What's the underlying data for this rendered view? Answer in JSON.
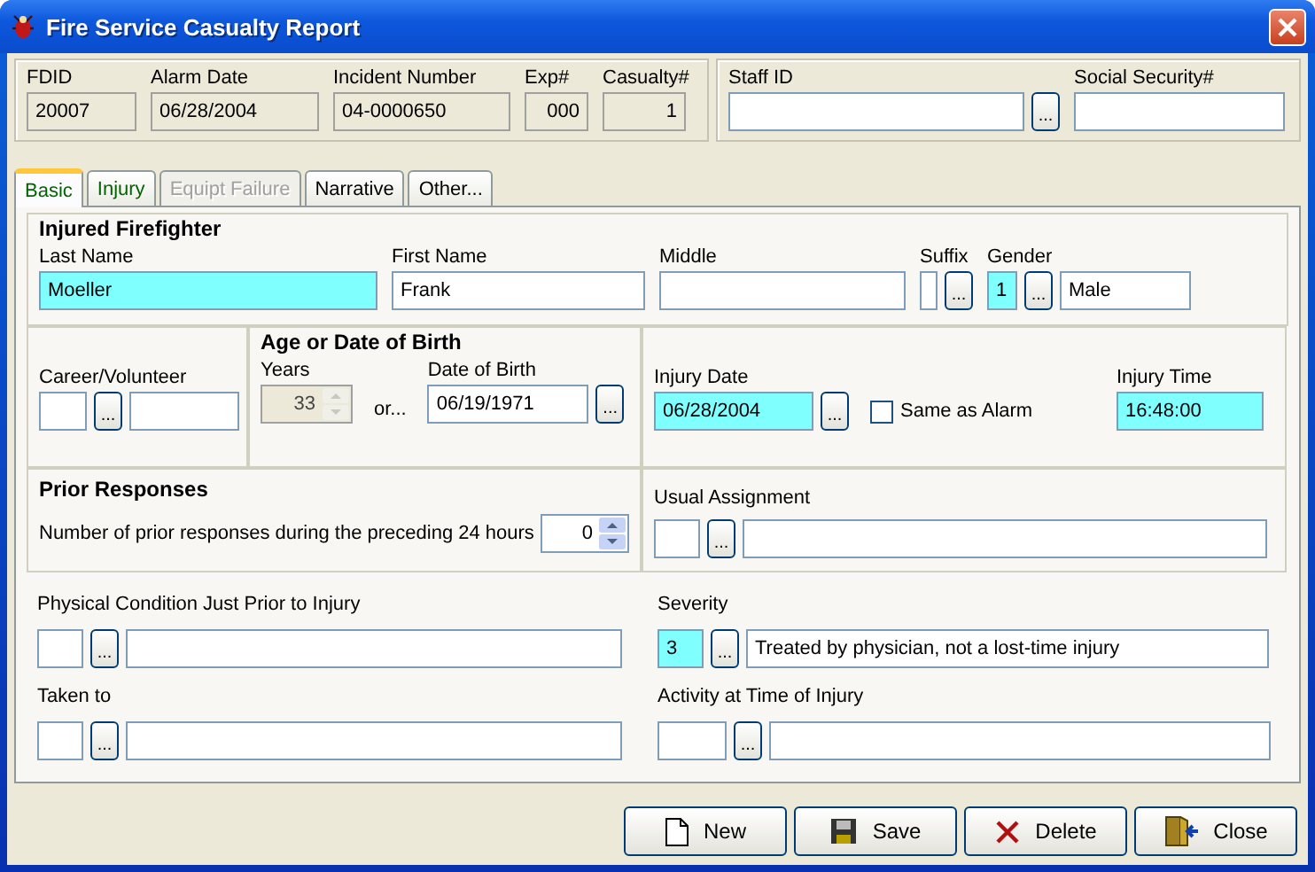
{
  "window": {
    "title": "Fire Service Casualty Report"
  },
  "incident": [
    {
      "label": "FDID",
      "value": "20007"
    },
    {
      "label": "Alarm Date",
      "value": "06/28/2004"
    },
    {
      "label": "Incident Number",
      "value": "04-0000650"
    },
    {
      "label": "Exp#",
      "value": "000"
    },
    {
      "label": "Casualty#",
      "value": "1"
    }
  ],
  "staff": {
    "staff_id": {
      "label": "Staff ID",
      "button": "..."
    },
    "social_security": {
      "label": "Social Security#"
    }
  },
  "tabs": [
    {
      "label": "Basic",
      "selected": true,
      "disabled": false,
      "color": "#006400"
    },
    {
      "label": "Injury",
      "selected": false,
      "disabled": false,
      "color": "#006400"
    },
    {
      "label": "Equipt Failure",
      "selected": false,
      "disabled": true,
      "color": "#a0a0a0"
    },
    {
      "label": "Narrative",
      "selected": false,
      "disabled": false,
      "color": "#000000"
    },
    {
      "label": "Other...",
      "selected": false,
      "disabled": false,
      "color": "#000000"
    }
  ],
  "injured_firefighter": {
    "title": "Injured Firefighter",
    "last_name": {
      "label": "Last Name",
      "value": "Moeller",
      "required": true
    },
    "first_name": {
      "label": "First Name",
      "value": "Frank",
      "required": false
    },
    "middle": {
      "label": "Middle",
      "required": false
    },
    "suffix": {
      "label": "Suffix",
      "required": false,
      "button": "..."
    },
    "gender": {
      "label": "Gender",
      "code": "1",
      "code_required": true,
      "button": "...",
      "description": "Male"
    }
  },
  "career_volunteer": {
    "label": "Career/Volunteer",
    "code_required": false,
    "button": "..."
  },
  "age": {
    "title": "Age or Date of Birth",
    "years_label": "Years",
    "years": "33",
    "or": "or...",
    "dob_label": "Date of Birth",
    "dob": "06/19/1971",
    "button": "..."
  },
  "injury_date": {
    "label": "Injury Date",
    "value": "06/28/2004",
    "required": true,
    "button": "...",
    "same_as_alarm": {
      "label": "Same as Alarm",
      "checked": false
    }
  },
  "injury_time": {
    "label": "Injury Time",
    "value": "16:48:00",
    "required": true
  },
  "prior_responses": {
    "title": "Prior Responses",
    "label": "Number of prior responses during the preceding 24 hours",
    "value": "0"
  },
  "usual_assignment": {
    "label": "Usual Assignment",
    "code_required": false,
    "button": "..."
  },
  "physical_condition": {
    "label": "Physical Condition Just Prior to Injury",
    "code_required": false,
    "button": "..."
  },
  "severity": {
    "label": "Severity",
    "code": "3",
    "code_required": true,
    "button": "...",
    "description": "Treated by physician, not a lost-time injury"
  },
  "taken_to": {
    "label": "Taken to",
    "code_required": false,
    "button": "..."
  },
  "activity": {
    "label": "Activity at Time of Injury",
    "code_required": false,
    "button": "..."
  },
  "buttons": [
    {
      "label": "New",
      "kind": "new"
    },
    {
      "label": "Save",
      "kind": "save"
    },
    {
      "label": "Delete",
      "kind": "delete"
    },
    {
      "label": "Close",
      "kind": "close"
    }
  ]
}
